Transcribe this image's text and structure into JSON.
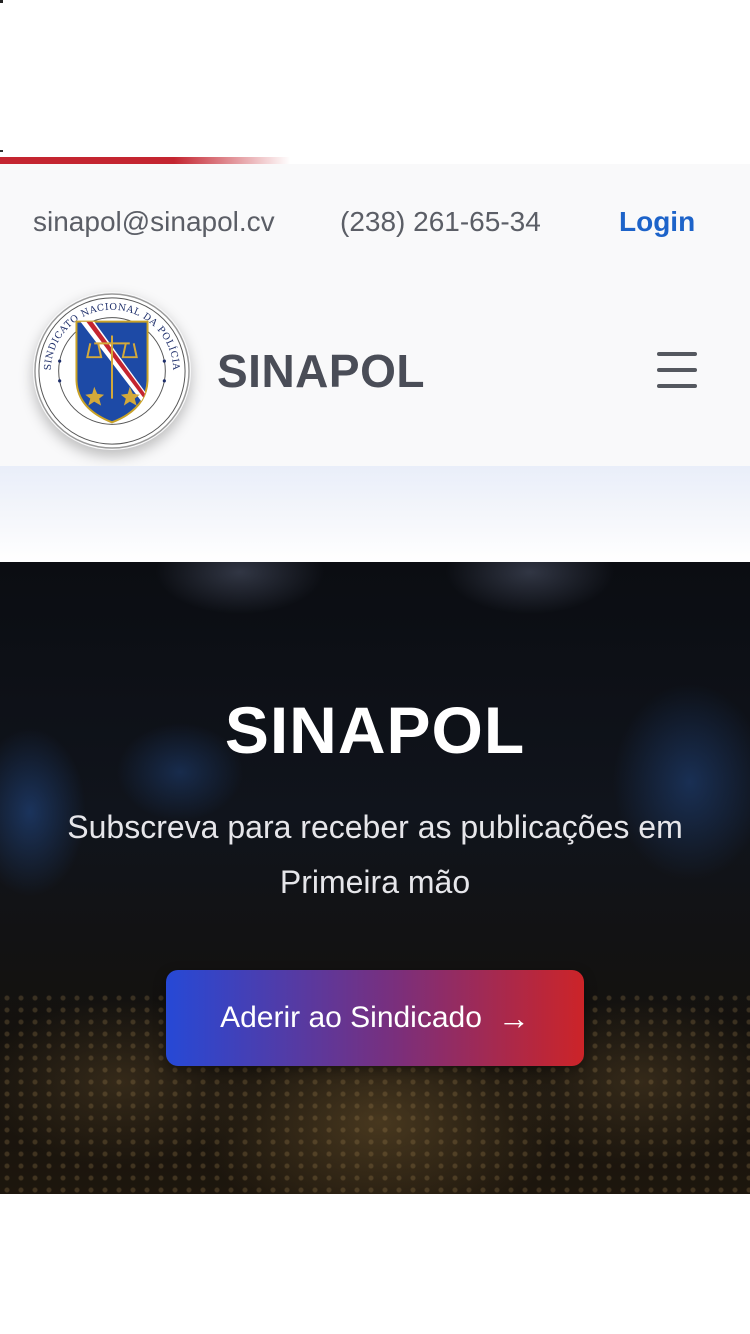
{
  "contact": {
    "email": "sinapol@sinapol.cv",
    "phone": "(238) 261-65-34",
    "login_label": "Login"
  },
  "header": {
    "brand": "SINAPOL",
    "logo_text": "SINDICATO NACIONAL DA POLÍCIA",
    "menu_icon": "hamburger-menu-icon"
  },
  "hero": {
    "title": "SINAPOL",
    "subtitle": "Subscreva para receber as publicações em Primeira mão",
    "cta_label": "Aderir ao Sindicado",
    "cta_icon": "arrow-right-icon",
    "arrow_glyph": "→"
  },
  "colors": {
    "accent_red": "#c42530",
    "link_blue": "#1d63c9",
    "cta_gradient_start": "#2649d6",
    "cta_gradient_end": "#cc2428",
    "brand_text": "#4a4d57"
  }
}
